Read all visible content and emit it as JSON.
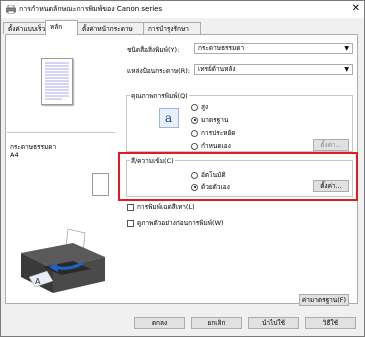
{
  "window": {
    "title": "การกำหนดลักษณะการพิมพ์ของ Canon series",
    "close": "✕"
  },
  "tabs": [
    {
      "label": "ตั้งค่าแบบเร็ว",
      "active": false
    },
    {
      "label": "หลัก",
      "active": true
    },
    {
      "label": "ตั้งค่าหน้ากระดาษ",
      "active": false
    },
    {
      "label": "การบำรุงรักษา",
      "active": false
    }
  ],
  "media": {
    "label": "ชนิดสื่อสิ่งพิมพ์(Y):",
    "value": "กระดาษธรรมดา"
  },
  "source": {
    "label": "แหล่งป้อนกระดาษ(R):",
    "value": "เทรย์ด้านหลัง"
  },
  "preview": {
    "paper_name": "กระดาษธรรมดา",
    "paper_size": "A4"
  },
  "quality": {
    "label": "คุณภาพการพิมพ์(Q)",
    "options": [
      {
        "label": "สูง",
        "selected": false
      },
      {
        "label": "มาตรฐาน",
        "selected": true
      },
      {
        "label": "การประหยัด",
        "selected": false
      },
      {
        "label": "กำหนดเอง",
        "selected": false
      }
    ],
    "set_button": "ตั้งค่า..."
  },
  "color": {
    "label": "สี/ความเข้ม(C)",
    "options": [
      {
        "label": "อัตโนมัติ",
        "selected": false
      },
      {
        "label": "ด้วยตัวเอง",
        "selected": true
      }
    ],
    "set_button": "ตั้งค่า..."
  },
  "grayscale": {
    "label": "การพิมพ์เฉดสีเทา(L)",
    "checked": false
  },
  "preview_before": {
    "label": "ดูภาพตัวอย่างก่อนการพิมพ์(W)",
    "checked": false
  },
  "defaults_button": "ค่ามาตรฐาน(F)",
  "footer": {
    "ok": "ตกลง",
    "cancel": "ยกเลิก",
    "apply": "นำไปใช้",
    "help": "วิธีใช้"
  },
  "colors": {
    "highlight": "#e31c23",
    "accent": "#1e64c8"
  }
}
